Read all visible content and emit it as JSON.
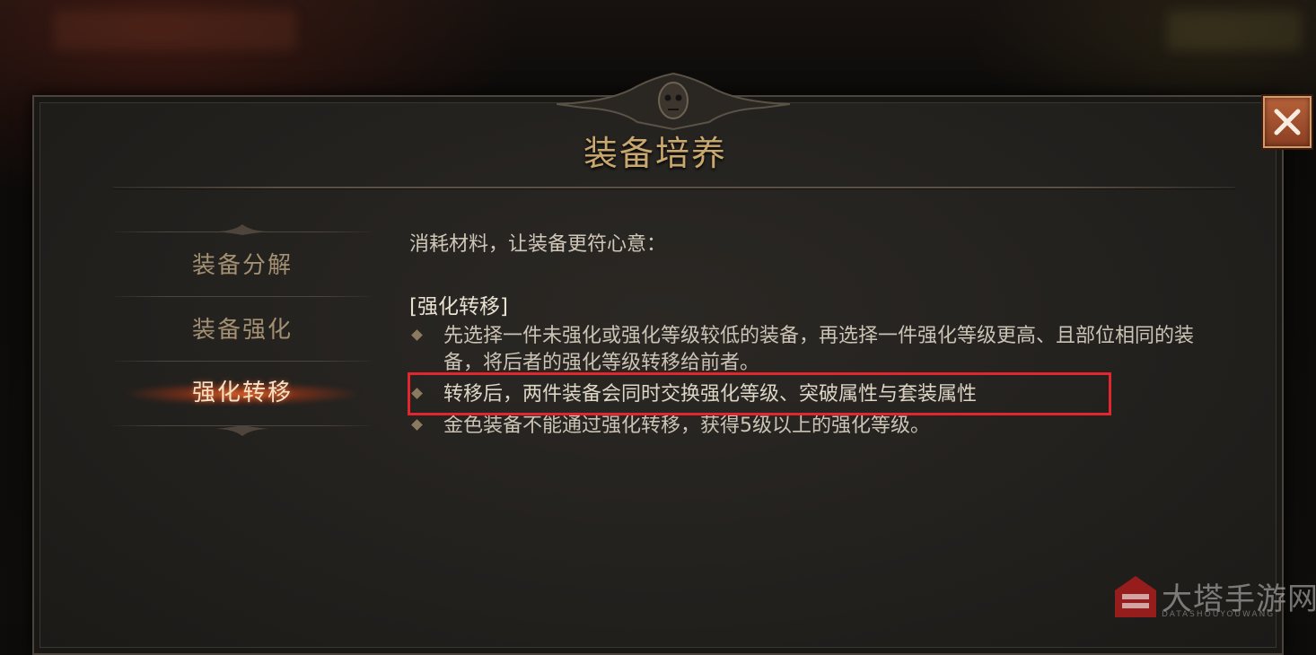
{
  "dialog": {
    "title": "装备培养",
    "close_icon": "close-x-icon"
  },
  "tabs": [
    {
      "label": "装备分解",
      "active": false
    },
    {
      "label": "装备强化",
      "active": false
    },
    {
      "label": "强化转移",
      "active": true
    }
  ],
  "content": {
    "intro": "消耗材料，让装备更符心意：",
    "heading": "[强化转移]",
    "rules": [
      "先选择一件未强化或强化等级较低的装备，再选择一件强化等级更高、且部位相同的装备，将后者的强化等级转移给前者。",
      "转移后，两件装备会同时交换强化等级、突破属性与套装属性",
      "金色装备不能通过强化转移，获得5级以上的强化等级。"
    ]
  },
  "watermark": {
    "name": "大塔手游网",
    "sub": "DATASHOUYOUWANG"
  },
  "colors": {
    "title": "#c9a86f",
    "highlight_border": "#e1262d",
    "close_button": "#a5532f"
  }
}
